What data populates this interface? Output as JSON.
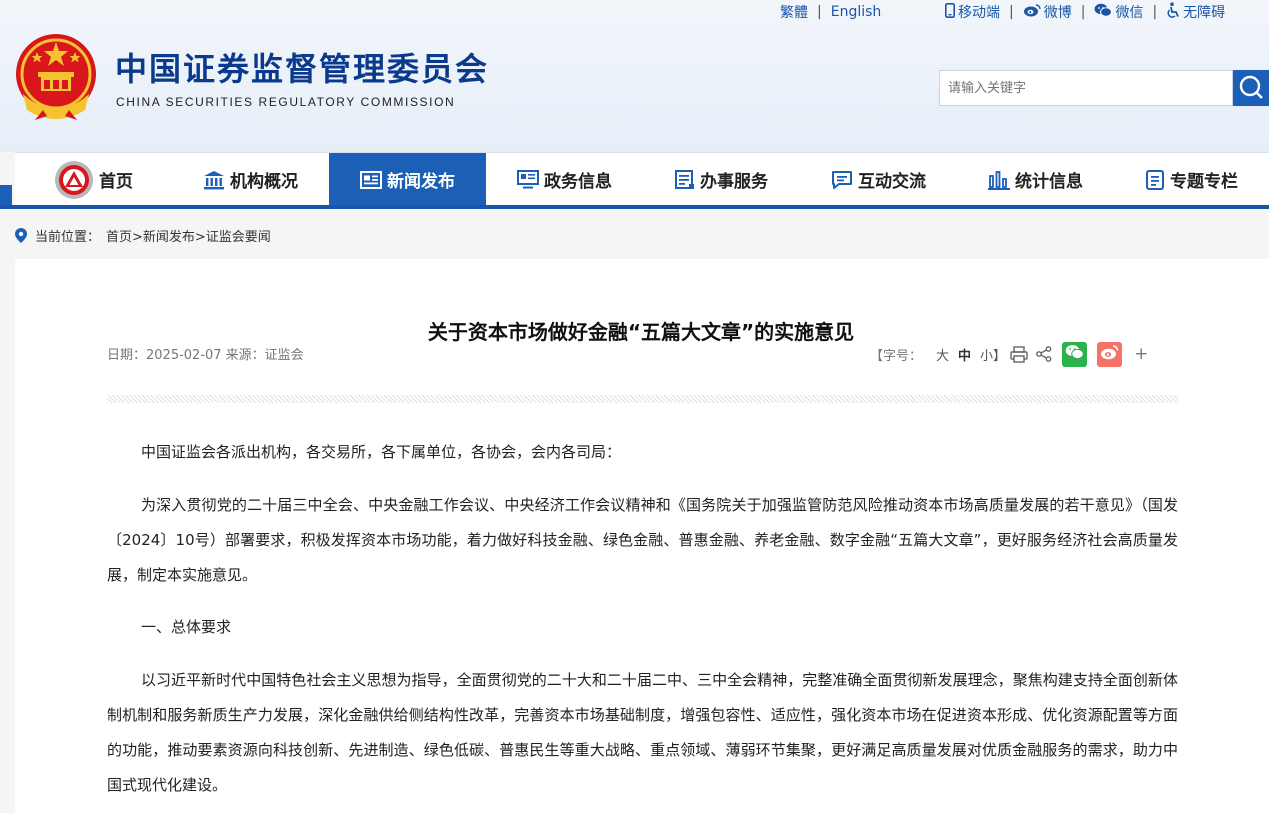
{
  "top_links": {
    "traditional": "繁體",
    "english": "English",
    "mobile": "移动端",
    "weibo": "微博",
    "wechat": "微信",
    "accessibility": "无障碍"
  },
  "site": {
    "title": "中国证券监督管理委员会",
    "subtitle": "CHINA SECURITIES REGULATORY COMMISSION"
  },
  "search": {
    "placeholder": "请输入关键字"
  },
  "nav": {
    "items": [
      {
        "label": "首页",
        "icon": "csrc-logo-icon"
      },
      {
        "label": "机构概况",
        "icon": "building-icon"
      },
      {
        "label": "新闻发布",
        "icon": "news-icon"
      },
      {
        "label": "政务信息",
        "icon": "monitor-icon"
      },
      {
        "label": "办事服务",
        "icon": "document-list-icon"
      },
      {
        "label": "互动交流",
        "icon": "chat-icon"
      },
      {
        "label": "统计信息",
        "icon": "bar-chart-icon"
      },
      {
        "label": "专题专栏",
        "icon": "page-icon"
      }
    ],
    "active": "新闻发布"
  },
  "breadcrumb": {
    "prefix": "当前位置：",
    "path": "首页>新闻发布>证监会要闻"
  },
  "article": {
    "title": "关于资本市场做好金融“五篇大文章”的实施意见",
    "meta": "日期：2025-02-07 来源：证监会",
    "font_size_label": "【字号：",
    "font_large": "大",
    "font_medium": "中",
    "font_small": "小】",
    "more": "+",
    "paragraphs": [
      "中国证监会各派出机构，各交易所，各下属单位，各协会，会内各司局：",
      "为深入贯彻党的二十届三中全会、中央金融工作会议、中央经济工作会议精神和《国务院关于加强监管防范风险推动资本市场高质量发展的若干意见》（国发〔2024〕10号）部署要求，积极发挥资本市场功能，着力做好科技金融、绿色金融、普惠金融、养老金融、数字金融“五篇大文章”，更好服务经济社会高质量发展，制定本实施意见。",
      "一、总体要求",
      "以习近平新时代中国特色社会主义思想为指导，全面贯彻党的二十大和二十届二中、三中全会精神，完整准确全面贯彻新发展理念，聚焦构建支持全面创新体制机制和服务新质生产力发展，深化金融供给侧结构性改革，完善资本市场基础制度，增强包容性、适应性，强化资本市场在促进资本形成、优化资源配置等方面的功能，推动要素资源向科技创新、先进制造、绿色低碳、普惠民生等重大战略、重点领域、薄弱环节集聚，更好满足高质量发展对优质金融服务的需求，助力中国式现代化建设。"
    ]
  },
  "colors": {
    "brand_blue": "#1c5fb6",
    "title_blue": "#0b3a8c",
    "wechat_green": "#2bb24c",
    "weibo_red": "#f47267"
  }
}
